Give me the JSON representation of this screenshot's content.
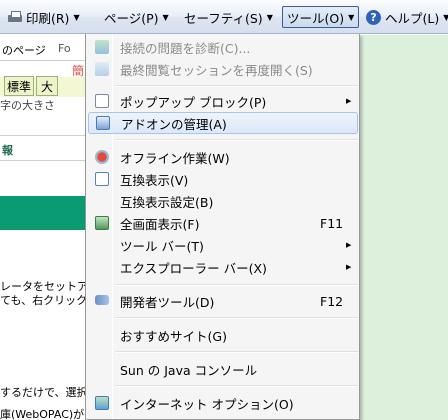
{
  "toolbar": {
    "print_label": "印刷(R)",
    "page_label": "ページ(P)",
    "safety_label": "セーフティ(S)",
    "tools_label": "ツール(O)",
    "help_label": "ヘルプ(L)",
    "arrow": "▼"
  },
  "background_page": {
    "tab_title": "のページ",
    "tab_title_short": "Fo",
    "red_text": "簡",
    "size_buttons": [
      "標準",
      "大"
    ],
    "size_caption": "字の大きさ",
    "section_heading": "報",
    "line1": "レータをセットアッ",
    "line2": "ても、右クリック",
    "line3": "するだけで、選択",
    "line4": "庫(WebOPAC)が"
  },
  "menu": {
    "items": [
      {
        "label": "接続の問題を診断(C)...",
        "disabled": true
      },
      {
        "label": "最終閲覧セッションを再度開く(S)",
        "disabled": true
      },
      {
        "label": "ポップアップ ブロック(P)",
        "submenu": "▶"
      },
      {
        "label": "アドオンの管理(A)",
        "highlighted": true
      },
      {
        "label": "オフライン作業(W)"
      },
      {
        "label": "互換表示(V)"
      },
      {
        "label": "互換表示設定(B)"
      },
      {
        "label": "全画面表示(F)",
        "shortcut": "F11"
      },
      {
        "label": "ツール バー(T)",
        "submenu": "▶"
      },
      {
        "label": "エクスプローラー バー(X)",
        "submenu": "▶"
      },
      {
        "label": "開発者ツール(D)",
        "shortcut": "F12"
      },
      {
        "label": "おすすめサイト(G)"
      },
      {
        "label": "Sun の Java コンソール"
      },
      {
        "label": "インターネット オプション(O)"
      }
    ]
  },
  "colors": {
    "accent_green": "#0b9b73",
    "menu_highlight": "#dce8f8",
    "disabled_text": "#8a8a8a"
  }
}
